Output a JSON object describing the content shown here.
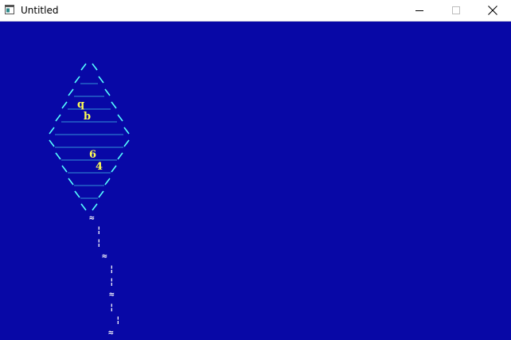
{
  "window": {
    "title": "Untitled",
    "icon": "app-window-icon",
    "controls": [
      "minimize-icon",
      "maximize-icon",
      "close-icon"
    ]
  },
  "scene": {
    "background": "#0808a6",
    "kite_edge_color": "#55ffff",
    "label_color": "#ffff55",
    "tail_color": "#ffffff",
    "kite_labels": [
      "q",
      "b",
      "6",
      "4"
    ],
    "tail_glyphs": [
      "≈",
      "¦",
      "¦",
      "≈",
      "¦",
      "¦",
      "≈",
      "¦",
      "¦",
      "≈"
    ]
  }
}
